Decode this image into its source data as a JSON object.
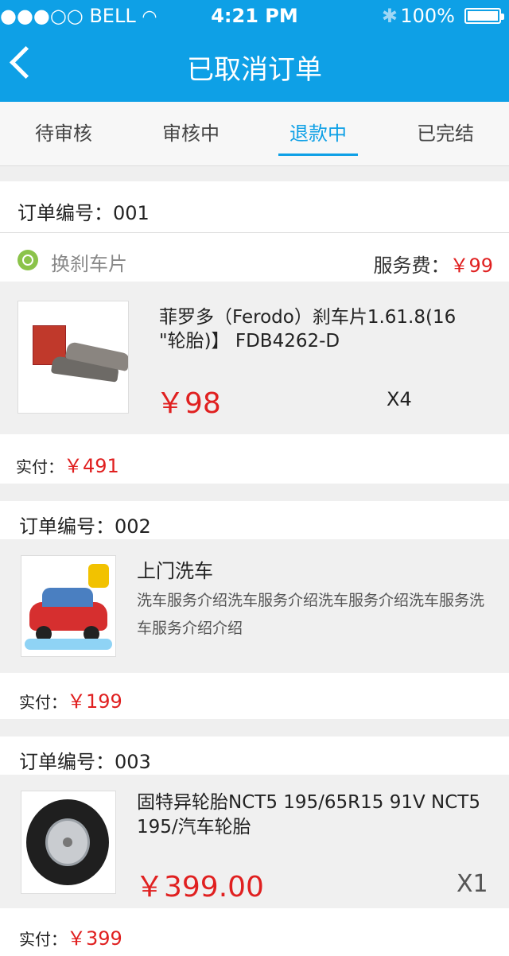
{
  "status_bar": {
    "carrier": "●●●○○ BELL",
    "time": "4:21 PM",
    "battery": "100%"
  },
  "header": {
    "title": "已取消订单"
  },
  "tabs": [
    "待审核",
    "审核中",
    "退款中",
    "已完结"
  ],
  "active_tab_index": 2,
  "colors": {
    "brand": "#0ea0e6",
    "price": "#e02020"
  },
  "orders": [
    {
      "order_no": "订单编号：001",
      "service": {
        "icon": "brake-disc-icon",
        "name": "换刹车片",
        "fee_label": "服务费：",
        "fee": "￥99"
      },
      "product": {
        "name": "菲罗多（Ferodo）刹车片1.61.8(16 \"轮胎)】 FDB4262-D",
        "price": "￥98",
        "qty": "X4"
      },
      "paid_label": "实付：",
      "paid_amount": "￥491"
    },
    {
      "order_no": "订单编号：002",
      "product": {
        "name": "上门洗车",
        "desc": "洗车服务介绍洗车服务介绍洗车服务介绍洗车服务洗车服务介绍介绍"
      },
      "paid_label": "实付：",
      "paid_amount": "￥199"
    },
    {
      "order_no": "订单编号：003",
      "product": {
        "name": "固特异轮胎NCT5 195/65R15 91V NCT5 195/汽车轮胎",
        "price": "￥399.00",
        "qty": "X1"
      },
      "paid_label": "实付：",
      "paid_amount": "￥399"
    }
  ]
}
